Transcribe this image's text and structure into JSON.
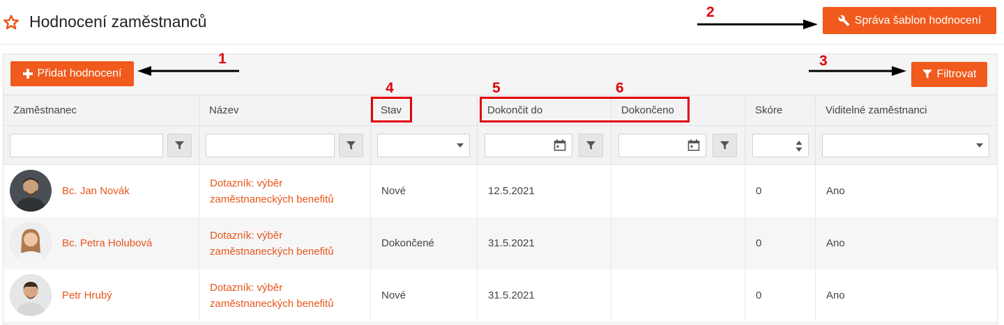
{
  "header": {
    "title": "Hodnocení zaměstnanců",
    "templates_button": "Správa šablon hodnocení"
  },
  "toolbar": {
    "add_button": "Přidat hodnocení",
    "filter_button": "Filtrovat"
  },
  "annotations": [
    "1",
    "2",
    "3",
    "4",
    "5",
    "6"
  ],
  "table": {
    "columns": [
      "Zaměstnanec",
      "Název",
      "Stav",
      "Dokončit do",
      "Dokončeno",
      "Skóre",
      "Viditelné zaměstnanci"
    ],
    "rows": [
      {
        "employee": "Bc. Jan Novák",
        "name_line1": "Dotazník: výběr",
        "name_line2": "zaměstnaneckých benefitů",
        "status": "Nové",
        "due": "12.5.2021",
        "completed": "",
        "score": "0",
        "visible": "Ano"
      },
      {
        "employee": "Bc. Petra Holubová",
        "name_line1": "Dotazník: výběr",
        "name_line2": "zaměstnaneckých benefitů",
        "status": "Dokončené",
        "due": "31.5.2021",
        "completed": "",
        "score": "0",
        "visible": "Ano"
      },
      {
        "employee": "Petr Hrubý",
        "name_line1": "Dotazník: výběr",
        "name_line2": "zaměstnaneckých benefitů",
        "status": "Nové",
        "due": "31.5.2021",
        "completed": "",
        "score": "0",
        "visible": "Ano"
      }
    ]
  },
  "colors": {
    "accent": "#f05a1c",
    "link": "#e8561b",
    "annotation": "#e0000b"
  },
  "icons": [
    "star-outline-icon",
    "wrench-icon",
    "plus-icon",
    "funnel-icon",
    "calendar-icon",
    "caret-down-icon",
    "spinner-arrows-icon",
    "person-avatar"
  ]
}
